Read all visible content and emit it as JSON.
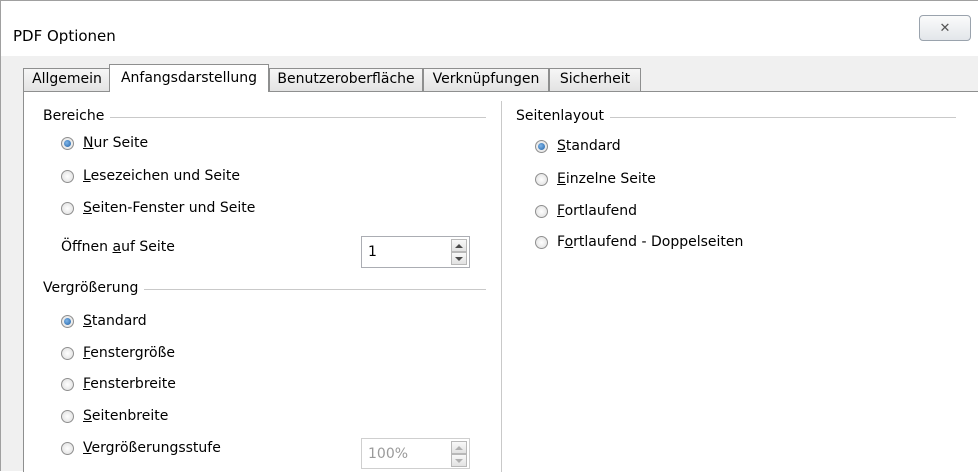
{
  "window": {
    "title": "PDF Optionen",
    "close_symbol": "✕"
  },
  "tabs": [
    {
      "label": "Allgemein",
      "active": false
    },
    {
      "label": "Anfangsdarstellung",
      "active": true
    },
    {
      "label": "Benutzeroberfläche",
      "active": false
    },
    {
      "label": "Verknüpfungen",
      "active": false
    },
    {
      "label": "Sicherheit",
      "active": false
    }
  ],
  "bereiche": {
    "title": "Bereiche",
    "options": [
      {
        "mnemonic": "N",
        "rest": "ur Seite",
        "checked": true
      },
      {
        "mnemonic": "L",
        "rest": "esezeichen und Seite",
        "checked": false
      },
      {
        "mnemonic": "S",
        "rest": "eiten-Fenster und Seite",
        "checked": false
      }
    ],
    "open_page": {
      "prefix": "Öffnen ",
      "mnemonic": "a",
      "suffix": "uf Seite",
      "value": "1"
    }
  },
  "vergroesserung": {
    "title": "Vergrößerung",
    "options": [
      {
        "mnemonic": "S",
        "rest": "tandard",
        "checked": true
      },
      {
        "mnemonic": "F",
        "rest": "enstergröße",
        "checked": false
      },
      {
        "mnemonic": "F",
        "rest": "ensterbreite",
        "checked": false
      },
      {
        "mnemonic": "S",
        "rest": "eitenbreite",
        "checked": false
      },
      {
        "mnemonic": "V",
        "rest": "ergrößerungsstufe",
        "checked": false
      }
    ],
    "zoom_value": "100%"
  },
  "seitenlayout": {
    "title": "Seitenlayout",
    "options": [
      {
        "mnemonic": "S",
        "rest": "tandard",
        "checked": true
      },
      {
        "mnemonic": "E",
        "rest": "inzelne Seite",
        "checked": false
      },
      {
        "mnemonic": "F",
        "rest": "ortlaufend",
        "checked": false
      },
      {
        "prefix": "F",
        "mnemonic": "o",
        "rest": "rtlaufend - Doppelseiten",
        "checked": false
      }
    ]
  }
}
